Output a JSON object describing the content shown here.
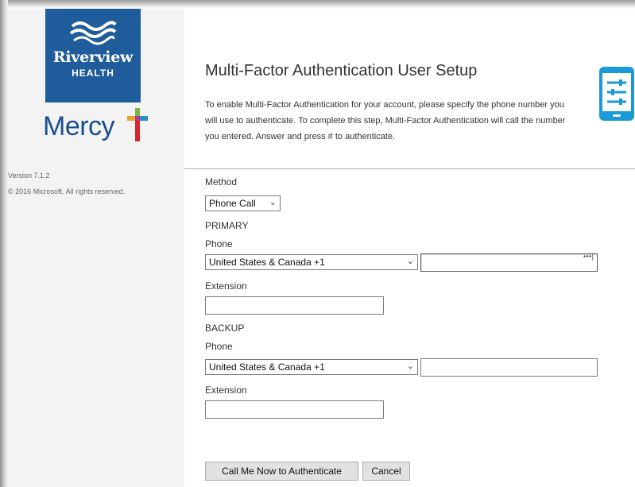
{
  "sidebar": {
    "logo_primary": {
      "name": "Riverview",
      "sub": "HEALTH"
    },
    "logo_secondary": {
      "name": "Mercy"
    },
    "version": "Version 7.1.2",
    "copyright": "© 2016 Microsoft. All rights reserved."
  },
  "main": {
    "title": "Multi-Factor Authentication User Setup",
    "intro": "To enable Multi-Factor Authentication for your account, please specify the phone number you will use to authenticate. To complete this step, Multi-Factor Authentication will call the number you entered. Answer and press # to authenticate.",
    "icon": "mobile-settings-icon",
    "brand_color": "#1f5c9b",
    "icon_color": "#1a9ad6"
  },
  "form": {
    "method_label": "Method",
    "method_value": "Phone Call",
    "primary_heading": "PRIMARY",
    "primary_phone_label": "Phone",
    "primary_country": "United States & Canada +1",
    "primary_phone_value": "",
    "primary_extension_label": "Extension",
    "primary_extension_value": "",
    "backup_heading": "BACKUP",
    "backup_phone_label": "Phone",
    "backup_country": "United States & Canada +1",
    "backup_phone_value": "",
    "backup_extension_label": "Extension",
    "backup_extension_value": ""
  },
  "buttons": {
    "call_now": "Call Me Now to Authenticate",
    "cancel": "Cancel"
  }
}
